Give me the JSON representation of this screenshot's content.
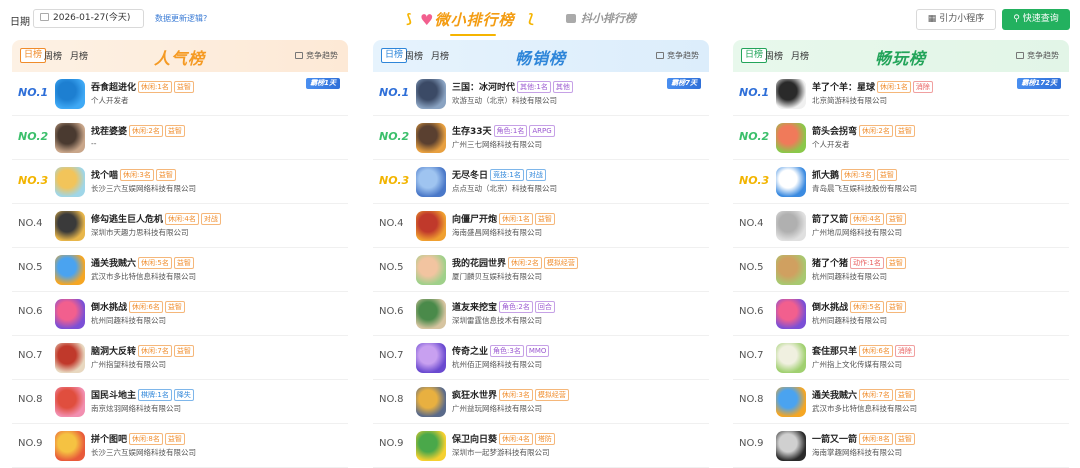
{
  "header": {
    "date_label": "日期",
    "date_value": "2026-01-27(今天)",
    "logic_link": "数据更新逻辑?",
    "main_tab_left_wing": "⟆",
    "main_tab_heart": "♥",
    "main_tab_label": "微小排行榜",
    "main_tab_right_wing": "⟅",
    "sub_tab_label": "抖小排行榜",
    "mini_program_button": "引力小程序",
    "query_button": "快速查询"
  },
  "boards": [
    {
      "title": "人气榜",
      "periods": [
        "日榜",
        "周榜",
        "月榜"
      ],
      "trend": "竞争趋势",
      "accent": "#f59a23",
      "rows": [
        {
          "rank": "NO.1",
          "name": "吞食超进化",
          "tags": [
            [
              "休闲:1名",
              "o"
            ],
            [
              "益智",
              "o"
            ]
          ],
          "company": "个人开发者",
          "badge": "霸榜1天",
          "icon_colors": [
            "#3fa9f5",
            "#1d7fd1"
          ]
        },
        {
          "rank": "NO.2",
          "name": "找茬婆婆",
          "tags": [
            [
              "休闲:2名",
              "o"
            ],
            [
              "益智",
              "o"
            ]
          ],
          "company": "--",
          "badge": "",
          "icon_colors": [
            "#c9a68a",
            "#4a3a30"
          ]
        },
        {
          "rank": "NO.3",
          "name": "找个喵",
          "tags": [
            [
              "休闲:3名",
              "o"
            ],
            [
              "益智",
              "o"
            ]
          ],
          "company": "长沙三六互娱网络科技有限公司",
          "badge": "",
          "icon_colors": [
            "#9fd6e8",
            "#f2c45a"
          ]
        },
        {
          "rank": "NO.4",
          "name": "修勾逃生巨人危机",
          "tags": [
            [
              "休闲:4名",
              "o"
            ],
            [
              "对战",
              "o"
            ]
          ],
          "company": "深圳市天趣力思科技有限公司",
          "badge": "",
          "icon_colors": [
            "#e8b64a",
            "#3a3a3a"
          ]
        },
        {
          "rank": "NO.5",
          "name": "通关我贼六",
          "tags": [
            [
              "休闲:5名",
              "o"
            ],
            [
              "益智",
              "o"
            ]
          ],
          "company": "武汉市多比特信息科技有限公司",
          "badge": "",
          "icon_colors": [
            "#f5a623",
            "#4aa3f0"
          ]
        },
        {
          "rank": "NO.6",
          "name": "倒水挑战",
          "tags": [
            [
              "休闲:6名",
              "o"
            ],
            [
              "益智",
              "o"
            ]
          ],
          "company": "杭州同趣科技有限公司",
          "badge": "",
          "icon_colors": [
            "#7b4fd6",
            "#f25f8e"
          ]
        },
        {
          "rank": "NO.7",
          "name": "脑洞大反转",
          "tags": [
            [
              "休闲:7名",
              "o"
            ],
            [
              "益智",
              "o"
            ]
          ],
          "company": "广州指望科技有限公司",
          "badge": "",
          "icon_colors": [
            "#e8d8c0",
            "#c0392b"
          ]
        },
        {
          "rank": "NO.8",
          "name": "国民斗地主",
          "tags": [
            [
              "棋牌:1名",
              "b"
            ],
            [
              "降失",
              "b"
            ]
          ],
          "company": "南京炫羽网络科技有限公司",
          "badge": "",
          "icon_colors": [
            "#f28fb0",
            "#e04e3e"
          ]
        },
        {
          "rank": "NO.9",
          "name": "拼个图吧",
          "tags": [
            [
              "休闲:8名",
              "o"
            ],
            [
              "益智",
              "o"
            ]
          ],
          "company": "长沙三六互娱网络科技有限公司",
          "badge": "",
          "icon_colors": [
            "#e85a3a",
            "#f5c242"
          ]
        }
      ]
    },
    {
      "title": "畅销榜",
      "periods": [
        "日榜",
        "周榜",
        "月榜"
      ],
      "trend": "竞争趋势",
      "accent": "#2f86d9",
      "rows": [
        {
          "rank": "NO.1",
          "name": "三国：冰河时代",
          "tags": [
            [
              "其他:1名",
              "p"
            ],
            [
              "其他",
              "p"
            ]
          ],
          "company": "欢游互动（北京）科技有限公司",
          "badge": "霸榜7天",
          "icon_colors": [
            "#8aa3c2",
            "#3b4a66"
          ]
        },
        {
          "rank": "NO.2",
          "name": "生存33天",
          "tags": [
            [
              "角色:1名",
              "p"
            ],
            [
              "ARPG",
              "p"
            ]
          ],
          "company": "广州三七网络科技有限公司",
          "badge": "",
          "icon_colors": [
            "#e8a040",
            "#5a4030"
          ]
        },
        {
          "rank": "NO.3",
          "name": "无尽冬日",
          "tags": [
            [
              "竞技:1名",
              "b"
            ],
            [
              "对战",
              "b"
            ]
          ],
          "company": "点点互动（北京）科技有限公司",
          "badge": "",
          "icon_colors": [
            "#4a78c8",
            "#9fc4f0"
          ]
        },
        {
          "rank": "NO.4",
          "name": "向僵尸开炮",
          "tags": [
            [
              "休闲:1名",
              "o"
            ],
            [
              "益智",
              "o"
            ]
          ],
          "company": "海南盛昌网络科技有限公司",
          "badge": "",
          "icon_colors": [
            "#f0a030",
            "#c0392b"
          ]
        },
        {
          "rank": "NO.5",
          "name": "我的花园世界",
          "tags": [
            [
              "休闲:2名",
              "o"
            ],
            [
              "模拟经营",
              "o"
            ]
          ],
          "company": "厦门麟贝互娱科技有限公司",
          "badge": "",
          "icon_colors": [
            "#9fd08a",
            "#f2c4a0"
          ]
        },
        {
          "rank": "NO.6",
          "name": "道友来挖宝",
          "tags": [
            [
              "角色:2名",
              "p"
            ],
            [
              "回合",
              "p"
            ]
          ],
          "company": "深圳雷霆信息技术有限公司",
          "badge": "",
          "icon_colors": [
            "#d6c4a0",
            "#4a8a4a"
          ]
        },
        {
          "rank": "NO.7",
          "name": "传奇之业",
          "tags": [
            [
              "角色:3名",
              "p"
            ],
            [
              "MMO",
              "p"
            ]
          ],
          "company": "杭州佰正网络科技有限公司",
          "badge": "",
          "icon_colors": [
            "#6a4ad0",
            "#c8a0f0"
          ]
        },
        {
          "rank": "NO.8",
          "name": "疯狂水世界",
          "tags": [
            [
              "休闲:3名",
              "o"
            ],
            [
              "模拟经营",
              "o"
            ]
          ],
          "company": "广州益玩网络科技有限公司",
          "badge": "",
          "icon_colors": [
            "#5a6a8a",
            "#e8b040"
          ]
        },
        {
          "rank": "NO.9",
          "name": "保卫向日葵",
          "tags": [
            [
              "休闲:4名",
              "o"
            ],
            [
              "塔防",
              "o"
            ]
          ],
          "company": "深圳市一起梦游科技有限公司",
          "badge": "",
          "icon_colors": [
            "#f5d030",
            "#4aa84a"
          ]
        }
      ]
    },
    {
      "title": "畅玩榜",
      "periods": [
        "日榜",
        "周榜",
        "月榜"
      ],
      "trend": "竞争趋势",
      "accent": "#23a45a",
      "rows": [
        {
          "rank": "NO.1",
          "name": "羊了个羊：星球",
          "tags": [
            [
              "休闲:1名",
              "o"
            ],
            [
              "消除",
              "r"
            ]
          ],
          "company": "北京简游科技有限公司",
          "badge": "霸榜172天",
          "icon_colors": [
            "#f0f0f0",
            "#2a2a2a"
          ]
        },
        {
          "rank": "NO.2",
          "name": "箭头会拐弯",
          "tags": [
            [
              "休闲:2名",
              "o"
            ],
            [
              "益智",
              "o"
            ]
          ],
          "company": "个人开发者",
          "badge": "",
          "icon_colors": [
            "#8ac84a",
            "#f07a5a"
          ]
        },
        {
          "rank": "NO.3",
          "name": "抓大鹅",
          "tags": [
            [
              "休闲:3名",
              "o"
            ],
            [
              "益智",
              "o"
            ]
          ],
          "company": "青岛晨飞互娱科技股份有限公司",
          "badge": "",
          "icon_colors": [
            "#3a8ae0",
            "#ffffff"
          ]
        },
        {
          "rank": "NO.4",
          "name": "箭了又箭",
          "tags": [
            [
              "休闲:4名",
              "o"
            ],
            [
              "益智",
              "o"
            ]
          ],
          "company": "广州地瓜网络科技有限公司",
          "badge": "",
          "icon_colors": [
            "#e0e0e0",
            "#b0b0b0"
          ]
        },
        {
          "rank": "NO.5",
          "name": "猪了个猪",
          "tags": [
            [
              "动作:1名",
              "r"
            ],
            [
              "益智",
              "o"
            ]
          ],
          "company": "杭州同趣科技有限公司",
          "badge": "",
          "icon_colors": [
            "#a8c870",
            "#d0a060"
          ]
        },
        {
          "rank": "NO.6",
          "name": "倒水挑战",
          "tags": [
            [
              "休闲:5名",
              "o"
            ],
            [
              "益智",
              "o"
            ]
          ],
          "company": "杭州同趣科技有限公司",
          "badge": "",
          "icon_colors": [
            "#7b4fd6",
            "#f25f8e"
          ]
        },
        {
          "rank": "NO.7",
          "name": "套住那只羊",
          "tags": [
            [
              "休闲:6名",
              "o"
            ],
            [
              "消除",
              "r"
            ]
          ],
          "company": "广州指上文化传媒有限公司",
          "badge": "",
          "icon_colors": [
            "#a0d070",
            "#f0f0e0"
          ]
        },
        {
          "rank": "NO.8",
          "name": "通关我贼六",
          "tags": [
            [
              "休闲:7名",
              "o"
            ],
            [
              "益智",
              "o"
            ]
          ],
          "company": "武汉市多比特信息科技有限公司",
          "badge": "",
          "icon_colors": [
            "#f5a623",
            "#4aa3f0"
          ]
        },
        {
          "rank": "NO.9",
          "name": "一箭又一箭",
          "tags": [
            [
              "休闲:8名",
              "o"
            ],
            [
              "益智",
              "o"
            ]
          ],
          "company": "海南掌趣网络科技有限公司",
          "badge": "",
          "icon_colors": [
            "#2a2a2a",
            "#d0d0d0"
          ]
        }
      ]
    }
  ]
}
